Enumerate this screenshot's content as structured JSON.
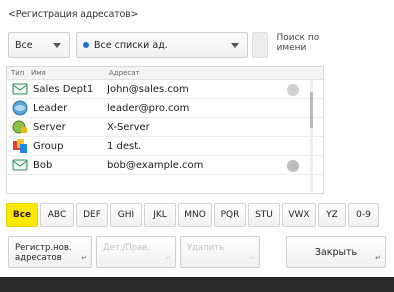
{
  "screen_title": "<Регистрация адресатов>",
  "filter": {
    "type_value": "Все",
    "list_value": "Все списки ад.",
    "search_by_name_label": "Поиск по имени"
  },
  "list": {
    "headers": [
      "Тип",
      "Имя",
      "Адресат"
    ],
    "rows": [
      {
        "icon": "email-icon",
        "name": "Sales Dept1",
        "dest": "John@sales.com",
        "mark": true
      },
      {
        "icon": "ifax-icon",
        "name": "Leader",
        "dest": "leader@pro.com",
        "mark": false
      },
      {
        "icon": "file-server-icon",
        "name": "Server",
        "dest": "X-Server",
        "mark": false
      },
      {
        "icon": "group-icon",
        "name": "Group",
        "dest": "1 dest.",
        "mark": false
      },
      {
        "icon": "email-icon",
        "name": "Bob",
        "dest": "bob@example.com",
        "mark": true
      }
    ]
  },
  "alpha_tabs": [
    "Все",
    "ABC",
    "DEF",
    "GHI",
    "JKL",
    "MNO",
    "PQR",
    "STU",
    "VWX",
    "YZ",
    "0-9"
  ],
  "alpha_active": "Все",
  "buttons": {
    "register": "Регистр.нов. адресатов",
    "detail": "Дет./Прав.",
    "delete": "Удалить",
    "close": "Закрыть"
  },
  "colors": {
    "active_tab": "#ffe800",
    "list_dot": "#1f6fd1"
  }
}
